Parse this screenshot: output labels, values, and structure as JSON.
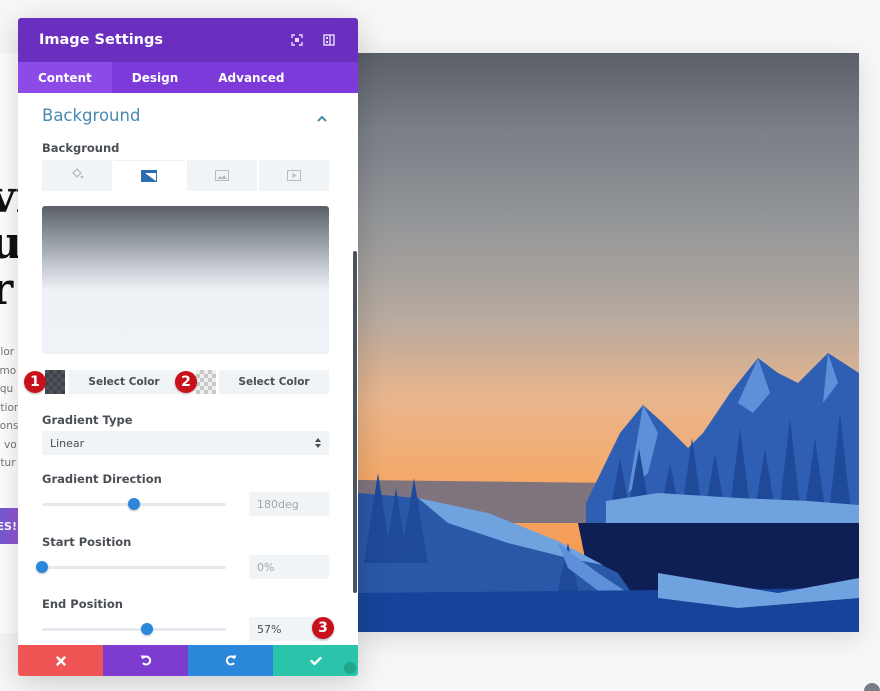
{
  "page": {
    "headline_lines": [
      "vi",
      "u",
      "r"
    ],
    "body_lines": [
      "olor",
      "smo",
      "liqu",
      "ation",
      "cons",
      "n vo",
      "atur"
    ],
    "cta_label": "ES!"
  },
  "panel": {
    "title": "Image Settings",
    "header_icons": [
      "focus-mode-icon",
      "sidebar-layout-icon"
    ],
    "tabs": [
      {
        "label": "Content",
        "active": true
      },
      {
        "label": "Design",
        "active": false
      },
      {
        "label": "Advanced",
        "active": false
      }
    ],
    "section_title": "Background",
    "background_label": "Background",
    "background_types": [
      {
        "name": "color",
        "icon": "paint-bucket-icon",
        "active": false
      },
      {
        "name": "gradient",
        "icon": "gradient-icon",
        "active": true
      },
      {
        "name": "image",
        "icon": "image-icon",
        "active": false
      },
      {
        "name": "video",
        "icon": "video-icon",
        "active": false
      }
    ],
    "color_stops": [
      {
        "label": "Select Color",
        "badge": "1"
      },
      {
        "label": "Select Color",
        "badge": "2"
      }
    ],
    "gradient_type": {
      "label": "Gradient Type",
      "value": "Linear"
    },
    "gradient_direction": {
      "label": "Gradient Direction",
      "value": "180deg",
      "slider_fraction": 0.5
    },
    "start_position": {
      "label": "Start Position",
      "value": "0%",
      "slider_fraction": 0.0
    },
    "end_position": {
      "label": "End Position",
      "value": "57%",
      "slider_fraction": 0.57,
      "badge": "3"
    },
    "footer": {
      "cancel": "close-icon",
      "undo": "undo-icon",
      "redo": "redo-icon",
      "save": "check-icon"
    }
  },
  "colors": {
    "header": "#6a2fbf",
    "tabs": "#7b3ad9",
    "accent_blue": "#2b87da",
    "section_title": "#4a8ab0",
    "cancel": "#ef5555",
    "undo": "#7e3bd0",
    "redo": "#2b87da",
    "save": "#29c4a9",
    "badge": "#c8101b"
  }
}
